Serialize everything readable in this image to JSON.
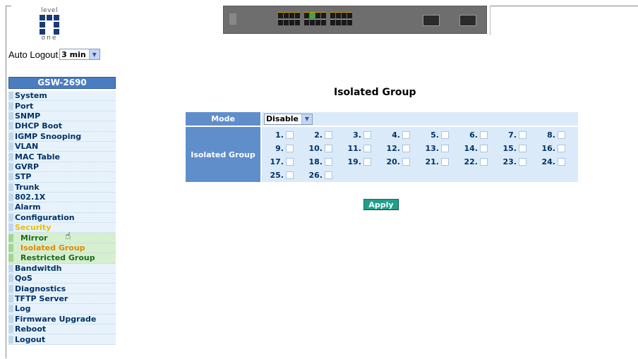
{
  "logo": {
    "top_text": "level",
    "bottom_text": "one"
  },
  "auto_logout": {
    "label": "Auto Logout",
    "value": "3 min"
  },
  "sidebar": {
    "title": "GSW-2690",
    "items": [
      {
        "label": "System",
        "type": "item"
      },
      {
        "label": "Port",
        "type": "item"
      },
      {
        "label": "SNMP",
        "type": "item"
      },
      {
        "label": "DHCP Boot",
        "type": "item"
      },
      {
        "label": "IGMP Snooping",
        "type": "item"
      },
      {
        "label": "VLAN",
        "type": "item"
      },
      {
        "label": "MAC Table",
        "type": "item"
      },
      {
        "label": "GVRP",
        "type": "item"
      },
      {
        "label": "STP",
        "type": "item"
      },
      {
        "label": "Trunk",
        "type": "item"
      },
      {
        "label": "802.1X",
        "type": "item"
      },
      {
        "label": "Alarm",
        "type": "item"
      },
      {
        "label": "Configuration",
        "type": "item"
      },
      {
        "label": "Security",
        "type": "section"
      },
      {
        "label": "Mirror",
        "type": "sub"
      },
      {
        "label": "Isolated Group",
        "type": "sub-active"
      },
      {
        "label": "Restricted Group",
        "type": "sub"
      },
      {
        "label": "Bandwitdh",
        "type": "item"
      },
      {
        "label": "QoS",
        "type": "item"
      },
      {
        "label": "Diagnostics",
        "type": "item"
      },
      {
        "label": "TFTP Server",
        "type": "item"
      },
      {
        "label": "Log",
        "type": "item"
      },
      {
        "label": "Firmware Upgrade",
        "type": "item"
      },
      {
        "label": "Reboot",
        "type": "item"
      },
      {
        "label": "Logout",
        "type": "item"
      }
    ]
  },
  "main": {
    "title": "Isolated Group",
    "mode_label": "Mode",
    "mode_value": "Disable",
    "group_label": "Isolated Group",
    "ports": [
      "1.",
      "2.",
      "3.",
      "4.",
      "5.",
      "6.",
      "7.",
      "8.",
      "9.",
      "10.",
      "11.",
      "12.",
      "13.",
      "14.",
      "15.",
      "16.",
      "17.",
      "18.",
      "19.",
      "20.",
      "21.",
      "22.",
      "23.",
      "24.",
      "25.",
      "26."
    ],
    "apply_label": "Apply"
  },
  "colors": {
    "header_blue": "#5f8ecb",
    "apply_teal": "#1fa08c",
    "security_yellow": "#e8c000",
    "active_orange": "#e08a00"
  }
}
